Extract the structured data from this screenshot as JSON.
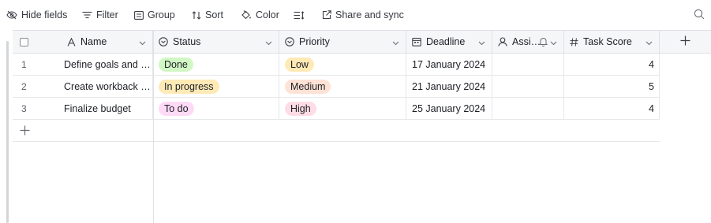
{
  "toolbar": {
    "hide_fields": "Hide fields",
    "filter": "Filter",
    "group": "Group",
    "sort": "Sort",
    "color": "Color",
    "share_sync": "Share and sync"
  },
  "columns": {
    "name": "Name",
    "status": "Status",
    "priority": "Priority",
    "deadline": "Deadline",
    "assignee": "Assi…",
    "task_score": "Task Score"
  },
  "rows": [
    {
      "num": "1",
      "name": "Define goals and t…",
      "status": "Done",
      "priority": "Low",
      "deadline": "17 January 2024",
      "assignee": "",
      "task_score": "4"
    },
    {
      "num": "2",
      "name": "Create workback …",
      "status": "In progress",
      "priority": "Medium",
      "deadline": "21 January 2024",
      "assignee": "",
      "task_score": "5"
    },
    {
      "num": "3",
      "name": "Finalize budget",
      "status": "To do",
      "priority": "High",
      "deadline": "25 January 2024",
      "assignee": "",
      "task_score": "4"
    }
  ],
  "colors": {
    "status_done_bg": "#d1f7c4",
    "status_inprogress_bg": "#ffeab6",
    "status_todo_bg": "#ffdaf6",
    "priority_low_bg": "#ffeab6",
    "priority_medium_bg": "#fee2d5",
    "priority_high_bg": "#ffdce5"
  },
  "icons": {
    "hide_fields": "eye-slash-icon",
    "filter": "filter-lines-icon",
    "group": "group-list-icon",
    "sort": "sort-arrows-icon",
    "color": "paint-bucket-icon",
    "row_height": "row-height-icon",
    "share": "share-external-icon",
    "search": "search-icon",
    "name_field": "text-a-icon",
    "status_field": "single-select-icon",
    "priority_field": "single-select-icon",
    "deadline_field": "calendar-icon",
    "assignee_field": "user-icon",
    "assignee_notify": "bell-icon",
    "task_score_field": "number-hash-icon",
    "add_field": "plus-icon",
    "add_row": "plus-icon"
  }
}
